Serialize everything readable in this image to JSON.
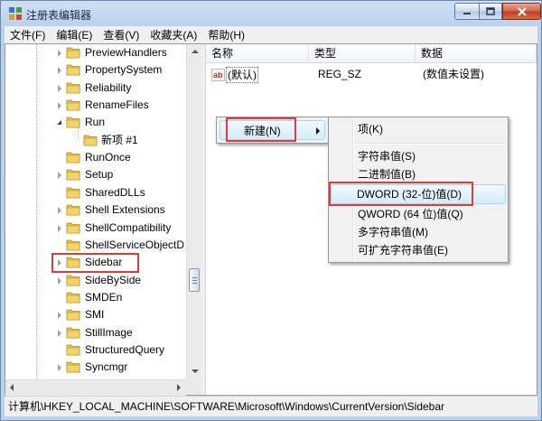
{
  "window": {
    "title": "注册表编辑器"
  },
  "menubar": [
    {
      "label": "文件(F)"
    },
    {
      "label": "编辑(E)"
    },
    {
      "label": "查看(V)"
    },
    {
      "label": "收藏夹(A)"
    },
    {
      "label": "帮助(H)"
    }
  ],
  "tree": [
    {
      "label": "PreviewHandlers",
      "expander": "closed"
    },
    {
      "label": "PropertySystem",
      "expander": "closed"
    },
    {
      "label": "Reliability",
      "expander": "closed"
    },
    {
      "label": "RenameFiles",
      "expander": "closed"
    },
    {
      "label": "Run",
      "expander": "open"
    },
    {
      "label": "新项 #1",
      "expander": "none",
      "child": true
    },
    {
      "label": "RunOnce",
      "expander": "none"
    },
    {
      "label": "Setup",
      "expander": "closed"
    },
    {
      "label": "SharedDLLs",
      "expander": "none"
    },
    {
      "label": "Shell Extensions",
      "expander": "closed"
    },
    {
      "label": "ShellCompatibility",
      "expander": "closed"
    },
    {
      "label": "ShellServiceObjectD",
      "expander": "none"
    },
    {
      "label": "Sidebar",
      "expander": "closed",
      "highlighted": true
    },
    {
      "label": "SideBySide",
      "expander": "closed"
    },
    {
      "label": "SMDEn",
      "expander": "none"
    },
    {
      "label": "SMI",
      "expander": "closed"
    },
    {
      "label": "StillImage",
      "expander": "closed"
    },
    {
      "label": "StructuredQuery",
      "expander": "none"
    },
    {
      "label": "Syncmgr",
      "expander": "closed"
    }
  ],
  "list": {
    "columns": [
      "名称",
      "类型",
      "数据"
    ],
    "rows": [
      {
        "icon": "ab",
        "name": "(默认)",
        "type": "REG_SZ",
        "data": "(数值未设置)"
      }
    ]
  },
  "context_menu": {
    "item": "新建(N)"
  },
  "submenu": {
    "items": [
      {
        "label": "项(K)"
      },
      {
        "label": "字符串值(S)"
      },
      {
        "label": "二进制值(B)"
      },
      {
        "label": "DWORD (32-位)值(D)",
        "highlighted": true
      },
      {
        "label": "QWORD (64 位)值(Q)"
      },
      {
        "label": "多字符串值(M)"
      },
      {
        "label": "可扩充字符串值(E)"
      }
    ]
  },
  "statusbar": {
    "path": "计算机\\HKEY_LOCAL_MACHINE\\SOFTWARE\\Microsoft\\Windows\\CurrentVersion\\Sidebar"
  },
  "colors": {
    "highlight_border": "#e03a3a",
    "folder": "#e8c04a",
    "menu_hover": "#d5ecfa"
  }
}
